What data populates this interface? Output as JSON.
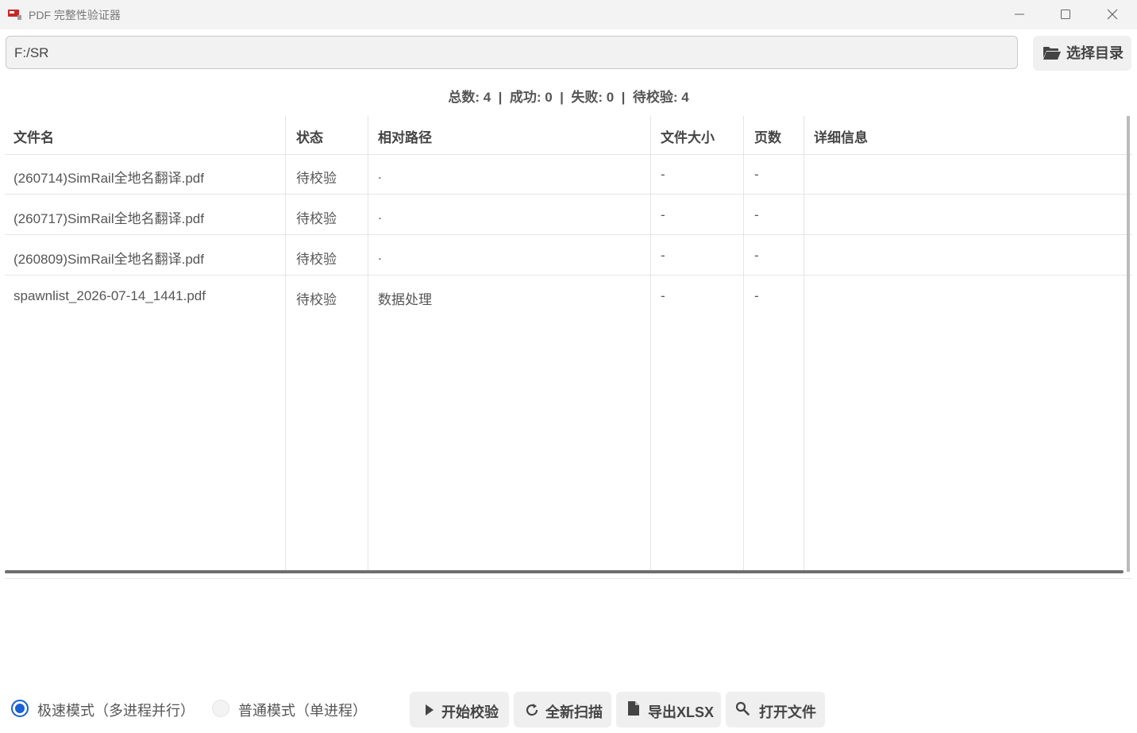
{
  "window": {
    "title": "PDF 完整性验证器"
  },
  "path_bar": {
    "value": "F:/SR",
    "choose_dir_label": "选择目录"
  },
  "stats": {
    "total": "总数: 4",
    "success": "成功: 0",
    "fail": "失败: 0",
    "pending": "待校验: 4",
    "separator": "  |  "
  },
  "table": {
    "columns": [
      "文件名",
      "状态",
      "相对路径",
      "文件大小",
      "页数",
      "详细信息"
    ],
    "rows": [
      {
        "name": "(260714)SimRail全地名翻译.pdf",
        "status": "待校验",
        "path": ".",
        "size": "-",
        "pages": "-",
        "detail": ""
      },
      {
        "name": "(260717)SimRail全地名翻译.pdf",
        "status": "待校验",
        "path": ".",
        "size": "-",
        "pages": "-",
        "detail": ""
      },
      {
        "name": "(260809)SimRail全地名翻译.pdf",
        "status": "待校验",
        "path": ".",
        "size": "-",
        "pages": "-",
        "detail": ""
      },
      {
        "name": "spawnlist_2026-07-14_1441.pdf",
        "status": "待校验",
        "path": "数据处理",
        "size": "-",
        "pages": "-",
        "detail": ""
      }
    ]
  },
  "mode": {
    "fast_label": "极速模式（多进程并行）",
    "normal_label": "普通模式（单进程）",
    "selected": "fast"
  },
  "actions": {
    "start": "开始校验",
    "rescan": "全新扫描",
    "export": "导出XLSX",
    "open": "打开文件"
  },
  "colors": {
    "accent": "#1a5fd6"
  }
}
